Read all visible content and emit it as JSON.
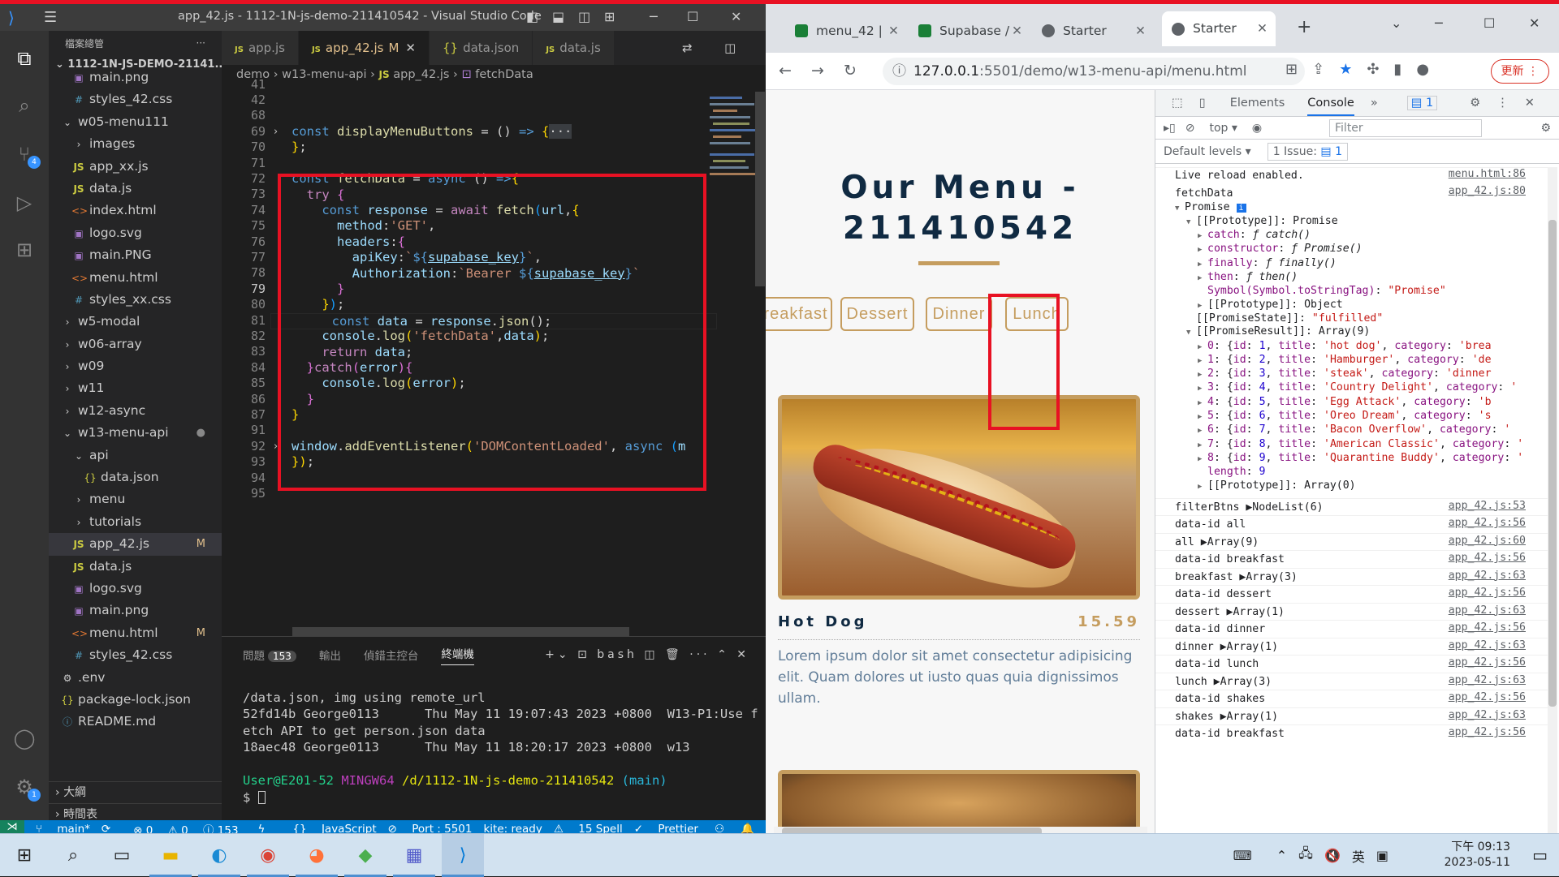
{
  "vscode": {
    "window_title": "app_42.js - 1112-1N-js-demo-211410542 - Visual Studio Code",
    "explorer_header": "檔案總管",
    "project_name": "1112-1N-JS-DEMO-21141...",
    "tree": [
      {
        "label": "main.png",
        "indent": 2,
        "type": "img"
      },
      {
        "label": "styles_42.css",
        "indent": 2,
        "type": "css"
      },
      {
        "label": "w05-menu111",
        "indent": 1,
        "type": "folder-open"
      },
      {
        "label": "images",
        "indent": 2,
        "type": "folder"
      },
      {
        "label": "app_xx.js",
        "indent": 2,
        "type": "js"
      },
      {
        "label": "data.js",
        "indent": 2,
        "type": "js"
      },
      {
        "label": "index.html",
        "indent": 2,
        "type": "html"
      },
      {
        "label": "logo.svg",
        "indent": 2,
        "type": "img"
      },
      {
        "label": "main.PNG",
        "indent": 2,
        "type": "img"
      },
      {
        "label": "menu.html",
        "indent": 2,
        "type": "html"
      },
      {
        "label": "styles_xx.css",
        "indent": 2,
        "type": "css"
      },
      {
        "label": "w5-modal",
        "indent": 1,
        "type": "folder"
      },
      {
        "label": "w06-array",
        "indent": 1,
        "type": "folder"
      },
      {
        "label": "w09",
        "indent": 1,
        "type": "folder"
      },
      {
        "label": "w11",
        "indent": 1,
        "type": "folder"
      },
      {
        "label": "w12-async",
        "indent": 1,
        "type": "folder"
      },
      {
        "label": "w13-menu-api",
        "indent": 1,
        "type": "folder-open",
        "mark": "●"
      },
      {
        "label": "api",
        "indent": 2,
        "type": "folder-open"
      },
      {
        "label": "data.json",
        "indent": 3,
        "type": "json"
      },
      {
        "label": "menu",
        "indent": 2,
        "type": "folder"
      },
      {
        "label": "tutorials",
        "indent": 2,
        "type": "folder"
      },
      {
        "label": "app_42.js",
        "indent": 2,
        "type": "js",
        "mark": "M",
        "selected": true
      },
      {
        "label": "data.js",
        "indent": 2,
        "type": "js"
      },
      {
        "label": "logo.svg",
        "indent": 2,
        "type": "img"
      },
      {
        "label": "main.png",
        "indent": 2,
        "type": "img"
      },
      {
        "label": "menu.html",
        "indent": 2,
        "type": "html",
        "mark": "M"
      },
      {
        "label": "styles_42.css",
        "indent": 2,
        "type": "css"
      },
      {
        "label": ".env",
        "indent": 1,
        "type": "gear"
      },
      {
        "label": "package-lock.json",
        "indent": 1,
        "type": "json"
      },
      {
        "label": "README.md",
        "indent": 1,
        "type": "info"
      }
    ],
    "outline_label": "大綱",
    "timeline_label": "時間表",
    "tabs": [
      {
        "label": "app.js",
        "active": false
      },
      {
        "label": "app_42.js",
        "active": true,
        "mark": "M"
      },
      {
        "label": "data.json",
        "active": false
      },
      {
        "label": "data.js",
        "active": false
      }
    ],
    "breadcrumb": [
      "demo",
      "w13-menu-api",
      "app_42.js",
      "fetchData"
    ],
    "line_numbers": [
      "41",
      "42",
      "68",
      "69",
      "70",
      "71",
      "72",
      "73",
      "74",
      "75",
      "76",
      "77",
      "78",
      "79",
      "80",
      "81",
      "82",
      "83",
      "84",
      "85",
      "86",
      "87",
      "91",
      "92",
      "93",
      "94",
      "95"
    ],
    "current_line": "79",
    "panel_tabs": [
      "問題",
      "輸出",
      "偵錯主控台",
      "終端機"
    ],
    "problems_count": "153",
    "terminal_shell": "bash",
    "terminal_lines": [
      "/data.json, img using remote_url",
      "52fd14b George0113      Thu May 11 19:07:43 2023 +0800  W13-P1:Use f",
      "etch API to get person.json data",
      "18aec48 George0113      Thu May 11 18:20:17 2023 +0800  w13"
    ],
    "prompt_user": "User@E201-52",
    "prompt_env": "MINGW64",
    "prompt_path": "/d/1112-1N-js-demo-211410542",
    "prompt_branch": "(main)",
    "status": {
      "branch": "main*",
      "errors": "⊗ 0",
      "warnings": "⚠ 0",
      "info": "ⓘ 153",
      "language": "JavaScript",
      "port": "Port : 5501",
      "kite": "kite: ready",
      "spell": "15 Spell",
      "prettier": "Prettier"
    }
  },
  "chrome": {
    "tabs": [
      {
        "label": "menu_42 |",
        "fav": "#1a7f37"
      },
      {
        "label": "Supabase /",
        "fav": "#1a7f37"
      },
      {
        "label": "Starter",
        "fav": "#5f6368"
      },
      {
        "label": "Starter",
        "fav": "#5f6368",
        "active": true
      }
    ],
    "url_host": "127.0.0.1",
    "url_path": ":5501/demo/w13-menu-api/menu.html",
    "update_label": "更新",
    "page": {
      "title": "Our Menu - 211410542",
      "filters": [
        "reakfast",
        "Dessert",
        "Dinner",
        "Lunch"
      ],
      "item_name": "Hot Dog",
      "item_price": "15.59",
      "item_desc": "Lorem ipsum dolor sit amet consectetur adipisicing elit. Quam dolores ut iusto quas quia dignissimos ullam."
    },
    "devtools": {
      "tabs": [
        "Elements",
        "Console"
      ],
      "issues_badge": "1",
      "context": "top",
      "filter_placeholder": "Filter",
      "levels": "Default levels",
      "issue_label": "1 Issue:",
      "issue_count": "1"
    }
  },
  "console": {
    "live_reload": "Live reload enabled.",
    "live_reload_src": "menu.html:86",
    "fetch_label": "fetchData",
    "fetch_src": "app_42.js:80",
    "items": [
      {
        "id": "1",
        "title": "hot dog",
        "cat": "brea"
      },
      {
        "id": "2",
        "title": "Hamburger",
        "cat": "de"
      },
      {
        "id": "3",
        "title": "steak",
        "cat": "dinner"
      },
      {
        "id": "4",
        "title": "Country Delight",
        "cat": ""
      },
      {
        "id": "5",
        "title": "Egg Attack",
        "cat": "b"
      },
      {
        "id": "6",
        "title": "Oreo Dream",
        "cat": "s"
      },
      {
        "id": "7",
        "title": "Bacon Overflow",
        "cat": ""
      },
      {
        "id": "8",
        "title": "American Classic",
        "cat": ""
      },
      {
        "id": "9",
        "title": "Quarantine Buddy",
        "cat": ""
      }
    ],
    "logs": [
      {
        "text": "filterBtns ▶NodeList(6)",
        "src": "app_42.js:53"
      },
      {
        "text": "data-id all",
        "src": "app_42.js:56"
      },
      {
        "text": "all ▶Array(9)",
        "src": "app_42.js:60"
      },
      {
        "text": "data-id breakfast",
        "src": "app_42.js:56"
      },
      {
        "text": "breakfast ▶Array(3)",
        "src": "app_42.js:63"
      },
      {
        "text": "data-id dessert",
        "src": "app_42.js:56"
      },
      {
        "text": "dessert ▶Array(1)",
        "src": "app_42.js:63"
      },
      {
        "text": "data-id dinner",
        "src": "app_42.js:56"
      },
      {
        "text": "dinner ▶Array(1)",
        "src": "app_42.js:63"
      },
      {
        "text": "data-id lunch",
        "src": "app_42.js:56"
      },
      {
        "text": "lunch ▶Array(3)",
        "src": "app_42.js:63"
      },
      {
        "text": "data-id shakes",
        "src": "app_42.js:56"
      },
      {
        "text": "shakes ▶Array(1)",
        "src": "app_42.js:63"
      },
      {
        "text": "data-id breakfast",
        "src": "app_42.js:56"
      }
    ]
  },
  "taskbar": {
    "ime": "英",
    "time": "下午 09:13",
    "date": "2023-05-11"
  }
}
